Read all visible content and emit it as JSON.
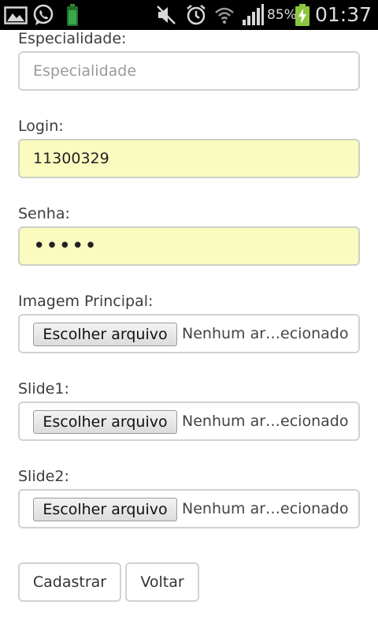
{
  "status_bar": {
    "battery_percent": "85%",
    "time": "01:37",
    "icons": [
      "gallery-icon",
      "whatsapp-icon",
      "battery-app-icon",
      "mute-icon",
      "alarm-icon",
      "wifi-icon",
      "signal-icon",
      "battery-charging-icon"
    ]
  },
  "form": {
    "especialidade": {
      "label": "Especialidade:",
      "placeholder": "Especialidade",
      "value": ""
    },
    "login": {
      "label": "Login:",
      "value": "11300329"
    },
    "senha": {
      "label": "Senha:",
      "value": "•••••"
    },
    "imagem_principal": {
      "label": "Imagem Principal:",
      "button": "Escolher arquivo",
      "status": "Nenhum ar…ecionado"
    },
    "slide1": {
      "label": "Slide1:",
      "button": "Escolher arquivo",
      "status": "Nenhum ar…ecionado"
    },
    "slide2": {
      "label": "Slide2:",
      "button": "Escolher arquivo",
      "status": "Nenhum ar…ecionado"
    }
  },
  "actions": {
    "cadastrar": "Cadastrar",
    "voltar": "Voltar"
  },
  "colors": {
    "filled_field_bg": "#fafcbf",
    "status_bar_bg": "#000000",
    "charging_green": "#8dc63f"
  }
}
